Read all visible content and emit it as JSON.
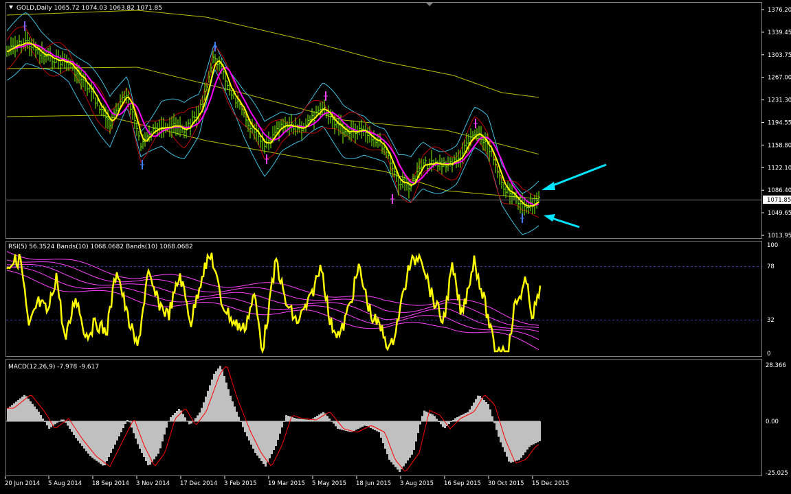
{
  "main_panel": {
    "header": "GOLD,Daily  1065.72 1074.03 1063.82 1071.85",
    "price_labels": [
      "1376.20",
      "1339.45",
      "1303.75",
      "1267.00",
      "1231.30",
      "1194.55",
      "1158.80",
      "1122.10",
      "1086.40",
      "1049.65",
      "1013.95"
    ],
    "current_price": "1071.85"
  },
  "rsi_panel": {
    "header": "RSI(5) 56.3524  Bands(10) 1068.0682  Bands(10) 1068.0682",
    "levels": [
      "100",
      "78",
      "32",
      "0"
    ]
  },
  "macd_panel": {
    "header": "MACD(12,26,9) -7.978 -9.617",
    "levels": [
      "28.366",
      "0.00",
      "-25.025"
    ]
  },
  "date_axis": [
    "20 Jun 2014",
    "5 Aug 2014",
    "18 Sep 2014",
    "3 Nov 2014",
    "17 Dec 2014",
    "3 Feb 2015",
    "19 Mar 2015",
    "5 May 2015",
    "18 Jun 2015",
    "3 Aug 2015",
    "16 Sep 2015",
    "30 Oct 2015",
    "15 Dec 2015"
  ],
  "colors": {
    "background": "#000000",
    "axis_text": "#ffffff",
    "price_bars": "#7cfc00",
    "ma_fast": "#ffff00",
    "ma_slow": "#ff00ff",
    "envelope": "#b8c000",
    "bollinger": "#40c0e0",
    "short_band": "#c00000",
    "rsi_line": "#ffff00",
    "rsi_bands": "#ff40ff",
    "macd_hist": "#c0c0c0",
    "macd_signal": "#ff0000",
    "annotation_arrow": "#00e5ff"
  }
}
